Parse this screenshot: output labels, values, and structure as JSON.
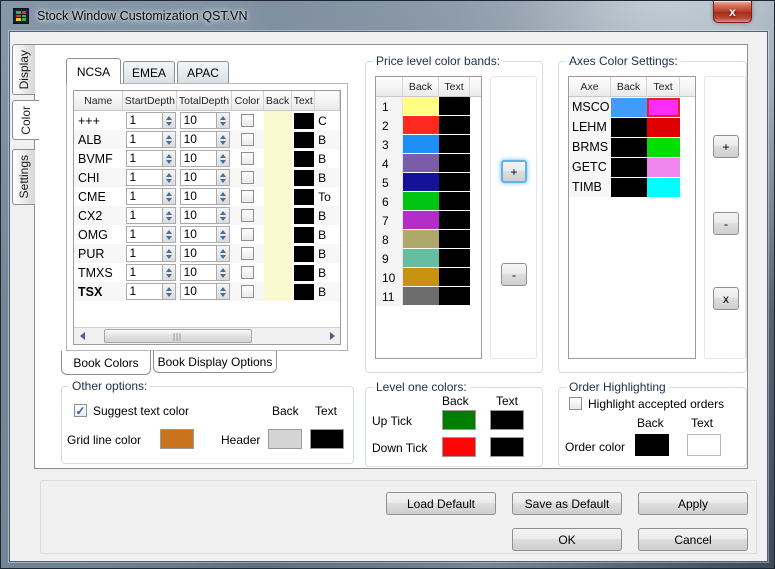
{
  "window": {
    "title": "Stock Window Customization QST.VN",
    "close_glyph": "x"
  },
  "side_tabs": [
    {
      "label": "Display"
    },
    {
      "label": "Color"
    },
    {
      "label": "Settings"
    }
  ],
  "book": {
    "region_tabs": [
      {
        "label": "NCSA"
      },
      {
        "label": "EMEA"
      },
      {
        "label": "APAC"
      }
    ],
    "columns": [
      "Name",
      "StartDepth",
      "TotalDepth",
      "Color",
      "Back",
      "Text"
    ],
    "rows": [
      {
        "name": "+++",
        "start": "1",
        "total": "10",
        "back": "#FBF9D0",
        "text": "#000000",
        "extra": "C"
      },
      {
        "name": "ALB",
        "start": "1",
        "total": "10",
        "back": "#FBF9D0",
        "text": "#000000",
        "extra": "B"
      },
      {
        "name": "BVMF",
        "start": "1",
        "total": "10",
        "back": "#FBF9D0",
        "text": "#000000",
        "extra": "B"
      },
      {
        "name": "CHI",
        "start": "1",
        "total": "10",
        "back": "#FBF9D0",
        "text": "#000000",
        "extra": "B"
      },
      {
        "name": "CME",
        "start": "1",
        "total": "10",
        "back": "#FBF9D0",
        "text": "#000000",
        "extra": "To"
      },
      {
        "name": "CX2",
        "start": "1",
        "total": "10",
        "back": "#FBF9D0",
        "text": "#000000",
        "extra": "B"
      },
      {
        "name": "OMG",
        "start": "1",
        "total": "10",
        "back": "#FBF9D0",
        "text": "#000000",
        "extra": "B"
      },
      {
        "name": "PUR",
        "start": "1",
        "total": "10",
        "back": "#FBF9D0",
        "text": "#000000",
        "extra": "B"
      },
      {
        "name": "TMXS",
        "start": "1",
        "total": "10",
        "back": "#FBF9D0",
        "text": "#000000",
        "extra": "B"
      },
      {
        "name": "TSX",
        "start": "1",
        "total": "10",
        "back": "#FBF9D0",
        "text": "#000000",
        "extra": "B"
      }
    ],
    "bottom_tabs": [
      {
        "label": "Book Colors"
      },
      {
        "label": "Book Display Options"
      }
    ]
  },
  "price_bands": {
    "title": "Price level color bands:",
    "back_header": "Back",
    "text_header": "Text",
    "add_label": "+",
    "remove_label": "-",
    "rows": [
      {
        "num": "1",
        "back": "#FFFF87",
        "text": "#000000"
      },
      {
        "num": "2",
        "back": "#FF2A1F",
        "text": "#000000"
      },
      {
        "num": "3",
        "back": "#1E90F5",
        "text": "#000000"
      },
      {
        "num": "4",
        "back": "#7A5DA8",
        "text": "#000000"
      },
      {
        "num": "5",
        "back": "#14129B",
        "text": "#000000"
      },
      {
        "num": "6",
        "back": "#00C414",
        "text": "#000000"
      },
      {
        "num": "7",
        "back": "#B42DC8",
        "text": "#000000"
      },
      {
        "num": "8",
        "back": "#AEA86B",
        "text": "#000000"
      },
      {
        "num": "9",
        "back": "#66BEA1",
        "text": "#000000"
      },
      {
        "num": "10",
        "back": "#C99110",
        "text": "#000000"
      },
      {
        "num": "11",
        "back": "#6D6D6D",
        "text": "#000000"
      }
    ]
  },
  "axes": {
    "title": "Axes Color Settings:",
    "axe_header": "Axe",
    "back_header": "Back",
    "text_header": "Text",
    "add_label": "+",
    "remove_label": "-",
    "delete_label": "x",
    "rows": [
      {
        "axe": "MSCO",
        "back": "#419BF9",
        "text": "#FB2BFA"
      },
      {
        "axe": "LEHM",
        "back": "#000000",
        "text": "#DE0000"
      },
      {
        "axe": "BRMS",
        "back": "#000000",
        "text": "#00DE00"
      },
      {
        "axe": "GETC",
        "back": "#000000",
        "text": "#EE86EE"
      },
      {
        "axe": "TIMB",
        "back": "#000000",
        "text": "#00FEFE"
      }
    ]
  },
  "other_options": {
    "title": "Other options:",
    "suggest_label": "Suggest  text color",
    "back_header": "Back",
    "text_header": "Text",
    "grid_line_label": "Grid line color",
    "grid_line_color": "#C9731D",
    "header_label": "Header",
    "header_back": "#D4D4D4",
    "header_text": "#000000"
  },
  "level_one": {
    "title": "Level one colors:",
    "back_header": "Back",
    "text_header": "Text",
    "rows": [
      {
        "label": "Up Tick",
        "back": "#007E00",
        "text": "#000000"
      },
      {
        "label": "Down Tick",
        "back": "#FE0606",
        "text": "#000000"
      }
    ]
  },
  "order_highlighting": {
    "title": "Order Highlighting",
    "checkbox_label": "Highlight accepted orders",
    "back_header": "Back",
    "text_header": "Text",
    "order_color_label": "Order color",
    "back": "#000000",
    "text": "#FFFFFF"
  },
  "action_buttons": {
    "load_default": "Load Default",
    "save_as_default": "Save as Default",
    "apply": "Apply",
    "ok": "OK",
    "cancel": "Cancel"
  }
}
